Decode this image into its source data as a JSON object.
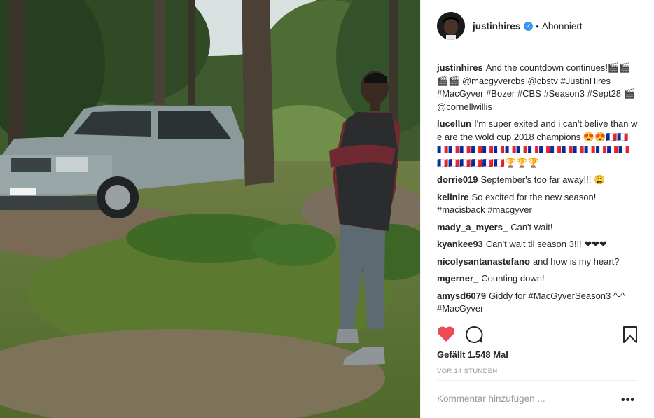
{
  "post": {
    "username": "justinhires",
    "follow_status": "Abonniert",
    "dot": "•",
    "verified_icon": "✓"
  },
  "comments": [
    {
      "user": "justinhires",
      "text": "And the countdown continues!🎬🎬 🎬🎬 @macgyvercbs @cbstv #JustinHires #MacGyver #Bozer #CBS #Season3 #Sept28 🎬 @cornellwillis"
    },
    {
      "user": "lucellun",
      "text": "I'm super exited and i can't belive than we are the wold cup 2018 champions 😍😍🇫🇷🇫🇷🇫🇷🇫🇷🇫🇷🇫🇷🇫🇷🇫🇷🇫🇷🇫🇷🇫🇷🇫🇷🇫🇷🇫🇷🇫🇷🇫🇷🇫🇷🇫🇷🇫🇷🇫🇷🇫🇷🇫🇷🇫🇷🇫🇷🇫🇷🏆🏆🏆"
    },
    {
      "user": "dorrie019",
      "text": "September's too far away!!! 😩"
    },
    {
      "user": "kellnire",
      "text": "So excited for the new season! #macisback #macgyver"
    },
    {
      "user": "mady_a_myers_",
      "text": "Can't wait!"
    },
    {
      "user": "kyankee93",
      "text": "Can't wait til season 3!!! ❤❤❤"
    },
    {
      "user": "nicolysantanastefano",
      "text": "and how is my heart?"
    },
    {
      "user": "mgerner_",
      "text": "Counting down!"
    },
    {
      "user": "amysd6079",
      "text": "Giddy for #MacGyverSeason3 ^-^ #MacGyver"
    }
  ],
  "likes_text": "Gefällt 1.548 Mal",
  "timestamp": "VOR 14 STUNDEN",
  "comment_input": {
    "placeholder": "Kommentar hinzufügen ..."
  },
  "more_label": "•••",
  "colors": {
    "heart": "#ed4956",
    "link": "#003569",
    "verified": "#3897f0"
  },
  "icons": {
    "like": "heart-icon",
    "comment": "comment-icon",
    "save": "bookmark-icon",
    "more": "more-options-icon"
  }
}
